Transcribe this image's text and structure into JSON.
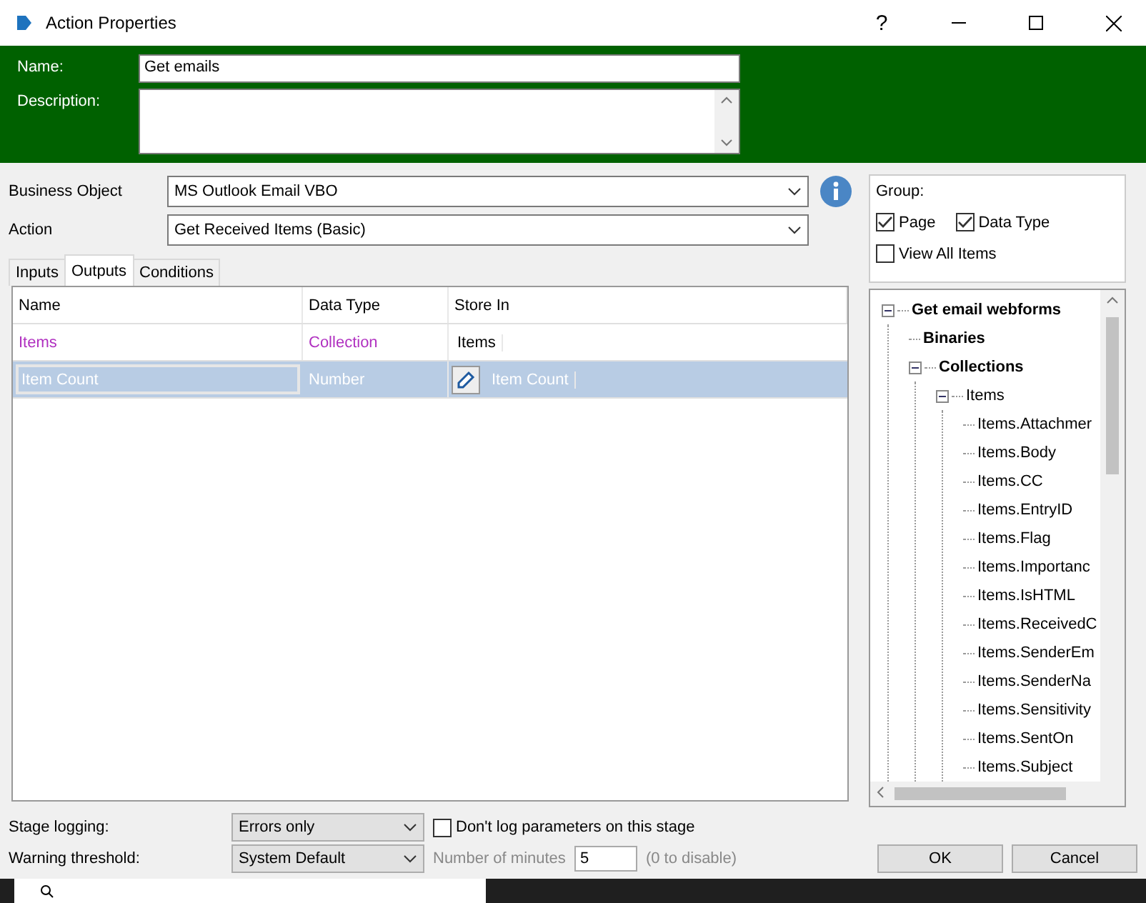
{
  "window": {
    "title": "Action Properties",
    "help": "?"
  },
  "header": {
    "name_label": "Name:",
    "name_value": "Get emails",
    "description_label": "Description:"
  },
  "business_object": {
    "label": "Business Object",
    "value": "MS Outlook Email VBO"
  },
  "action": {
    "label": "Action",
    "value": "Get Received Items (Basic)"
  },
  "tabs": [
    {
      "label": "Inputs",
      "selected": false
    },
    {
      "label": "Outputs",
      "selected": true
    },
    {
      "label": "Conditions",
      "selected": false
    }
  ],
  "table": {
    "columns": [
      "Name",
      "Data Type",
      "Store In"
    ],
    "rows": [
      {
        "name": "Items",
        "data_type": "Collection",
        "store_in": "Items",
        "kind": "collection",
        "selected": false
      },
      {
        "name": "Item Count",
        "data_type": "Number",
        "store_in": "Item Count",
        "kind": "value",
        "selected": true
      }
    ]
  },
  "group": {
    "label": "Group:",
    "options": [
      {
        "label": "Page",
        "checked": true
      },
      {
        "label": "Data Type",
        "checked": true
      }
    ],
    "view_all": {
      "label": "View All Items",
      "checked": false
    }
  },
  "tree": [
    {
      "label": "Get email webforms",
      "bold": true,
      "expanded": true,
      "children": [
        {
          "label": "Binaries",
          "bold": true
        },
        {
          "label": "Collections",
          "bold": true,
          "expanded": true,
          "children": [
            {
              "label": "Items",
              "bold": false,
              "expanded": true,
              "children": [
                {
                  "label": "Items.Attachmer"
                },
                {
                  "label": "Items.Body"
                },
                {
                  "label": "Items.CC"
                },
                {
                  "label": "Items.EntryID"
                },
                {
                  "label": "Items.Flag"
                },
                {
                  "label": "Items.Importanc"
                },
                {
                  "label": "Items.IsHTML"
                },
                {
                  "label": "Items.ReceivedC"
                },
                {
                  "label": "Items.SenderEm"
                },
                {
                  "label": "Items.SenderNa"
                },
                {
                  "label": "Items.Sensitivity"
                },
                {
                  "label": "Items.SentOn"
                },
                {
                  "label": "Items.Subject"
                }
              ]
            }
          ]
        }
      ]
    }
  ],
  "stage_logging": {
    "label": "Stage logging:",
    "value": "Errors only",
    "dont_log": {
      "label": "Don't log parameters on this stage",
      "checked": false
    }
  },
  "warning": {
    "label": "Warning threshold:",
    "value": "System Default",
    "minutes_label": "Number of minutes",
    "minutes": "5",
    "hint": "(0 to disable)"
  },
  "buttons": [
    "OK",
    "Cancel"
  ]
}
